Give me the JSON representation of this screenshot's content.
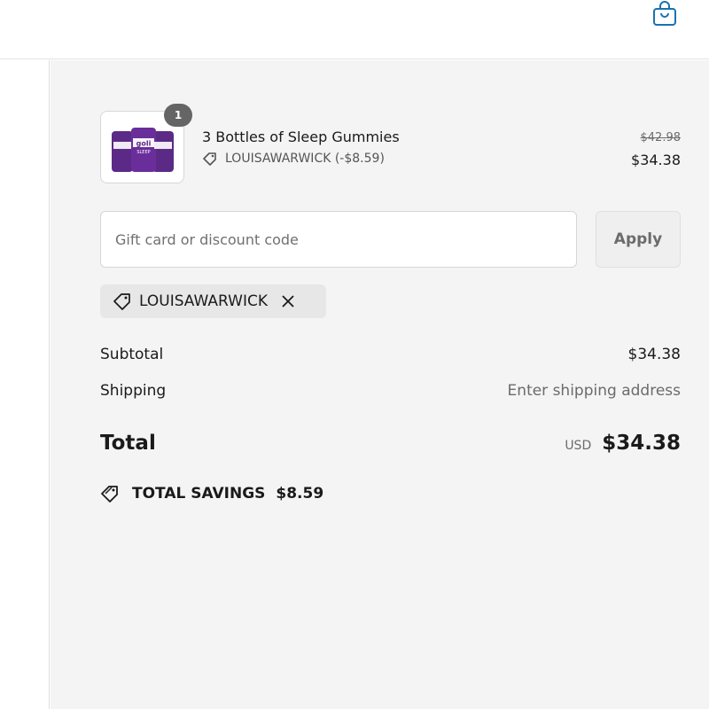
{
  "header": {
    "cart_icon": "shopping-bag-icon"
  },
  "line_item": {
    "quantity": "1",
    "title": "3 Bottles of Sleep Gummies",
    "discount_label": "LOUISAWARWICK (-$8.59)",
    "original_price": "$42.98",
    "price": "$34.38",
    "product_label": "goli",
    "product_sublabel": "SLEEP"
  },
  "discount_form": {
    "placeholder": "Gift card or discount code",
    "value": "",
    "apply_label": "Apply"
  },
  "applied_code": {
    "code": "LOUISAWARWICK"
  },
  "totals": {
    "subtotal_label": "Subtotal",
    "subtotal_value": "$34.38",
    "shipping_label": "Shipping",
    "shipping_value": "Enter shipping address",
    "total_label": "Total",
    "currency": "USD",
    "total_value": "$34.38"
  },
  "savings": {
    "label": "TOTAL SAVINGS",
    "amount": "$8.59"
  },
  "colors": {
    "accent": "#1773b0",
    "summary_bg": "#f4f4f4",
    "badge": "#656565",
    "product_purple": "#5b2a86"
  }
}
